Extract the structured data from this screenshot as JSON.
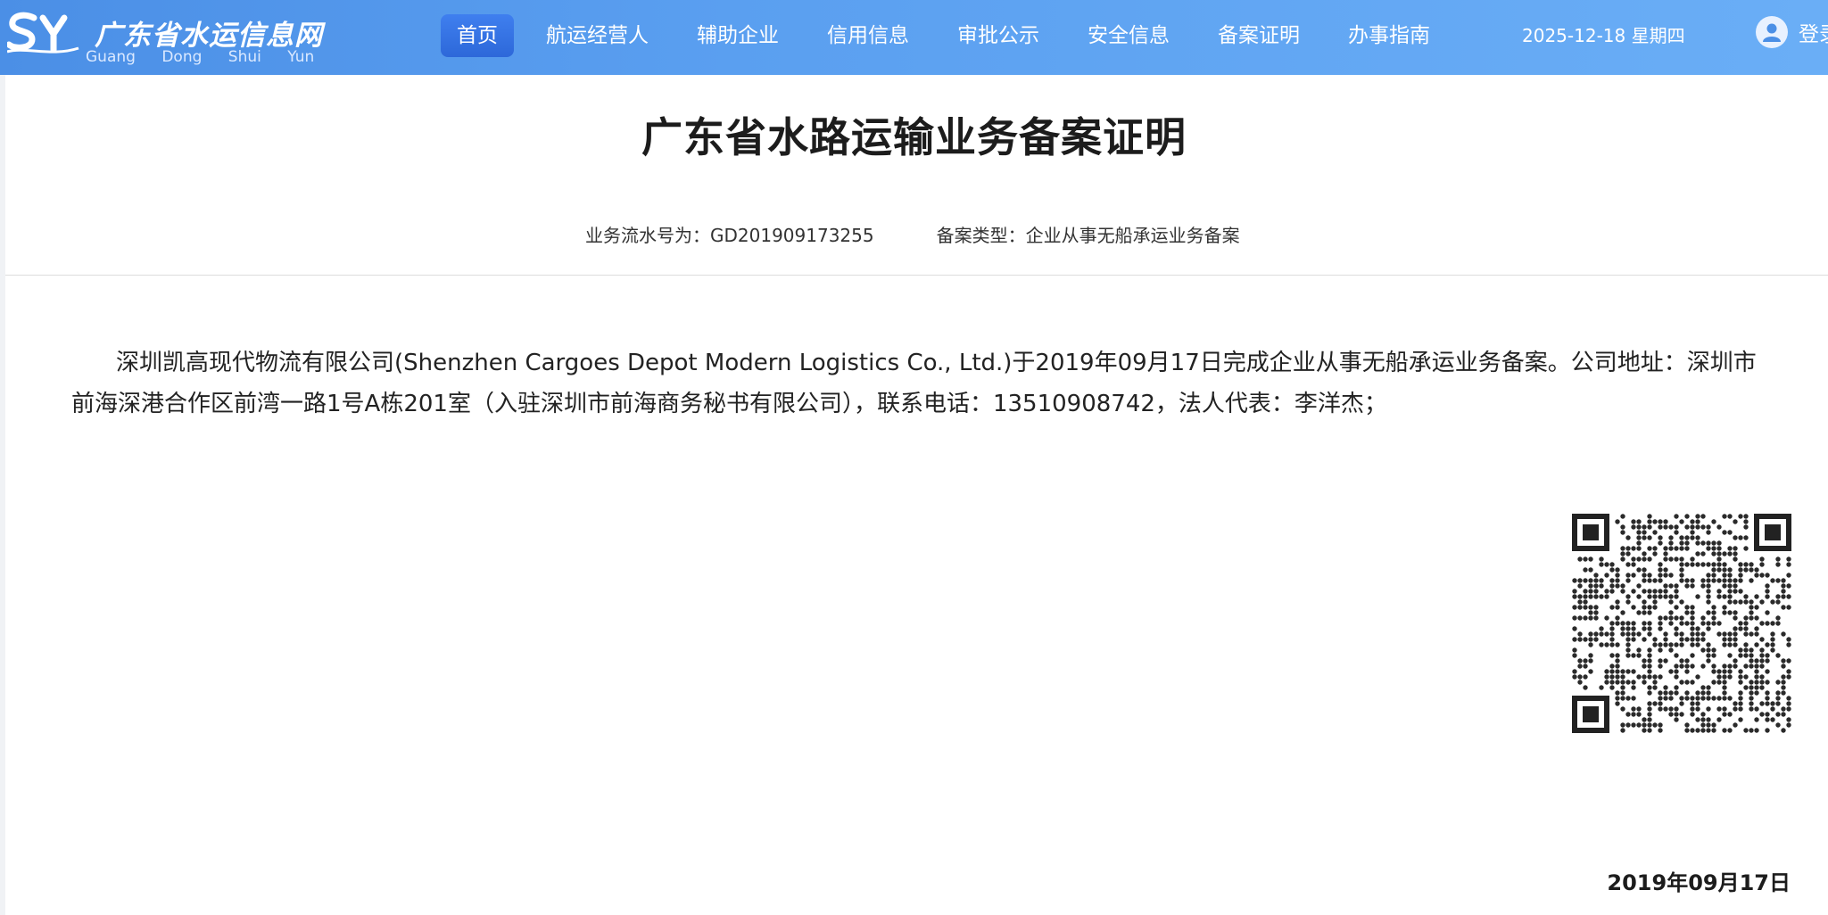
{
  "header": {
    "logo_title": "广东省水运信息网",
    "logo_subtitle": "Guang Dong Shui Yun",
    "nav": [
      {
        "label": "首页",
        "active": true
      },
      {
        "label": "航运经营人",
        "active": false
      },
      {
        "label": "辅助企业",
        "active": false
      },
      {
        "label": "信用信息",
        "active": false
      },
      {
        "label": "审批公示",
        "active": false
      },
      {
        "label": "安全信息",
        "active": false
      },
      {
        "label": "备案证明",
        "active": false
      },
      {
        "label": "办事指南",
        "active": false
      }
    ],
    "date": "2025-12-18 星期四",
    "login": "登录",
    "avatar_icon": "user-avatar-icon"
  },
  "document": {
    "title": "广东省水路运输业务备案证明",
    "serial_label": "业务流水号为：GD201909173255",
    "type_label": "备案类型：企业从事无船承运业务备案",
    "body": "深圳凯高现代物流有限公司(Shenzhen Cargoes Depot Modern Logistics Co., Ltd.)于2019年09月17日完成企业从事无船承运业务备案。公司地址：深圳市前海深港合作区前湾一路1号A栋201室（入驻深圳市前海商务秘书有限公司），联系电话：13510908742，法人代表：李洋杰；",
    "sign_date": "2019年09月17日",
    "qr_icon": "qr-code"
  },
  "colors": {
    "header_start": "#4b8fe6",
    "header_end": "#6aaef6",
    "nav_active": "#2d68d9"
  }
}
